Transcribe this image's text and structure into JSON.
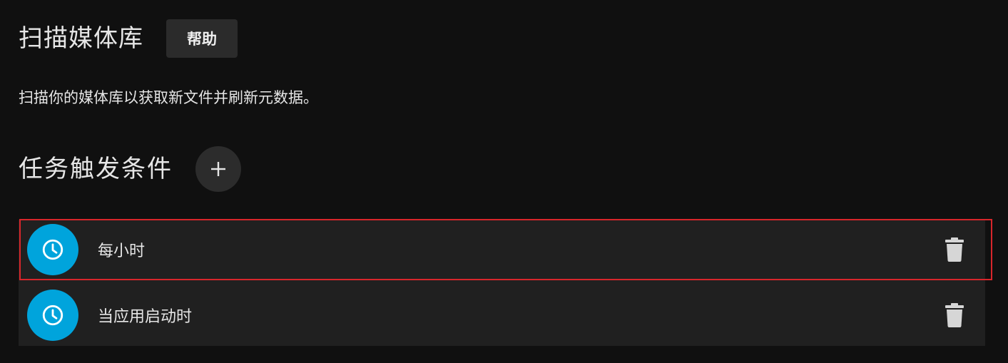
{
  "header": {
    "title": "扫描媒体库",
    "help_label": "帮助"
  },
  "description": "扫描你的媒体库以获取新文件并刷新元数据。",
  "triggers_section": {
    "title": "任务触发条件",
    "add_icon": "plus-icon",
    "items": [
      {
        "label": "每小时",
        "icon": "clock-icon",
        "delete_icon": "trash-icon",
        "selected": true
      },
      {
        "label": "当应用启动时",
        "icon": "clock-icon",
        "delete_icon": "trash-icon",
        "selected": false
      }
    ]
  },
  "colors": {
    "background": "#101010",
    "accent": "#00a4dc",
    "list_background": "#202020",
    "selection_outline": "#d8262b"
  }
}
